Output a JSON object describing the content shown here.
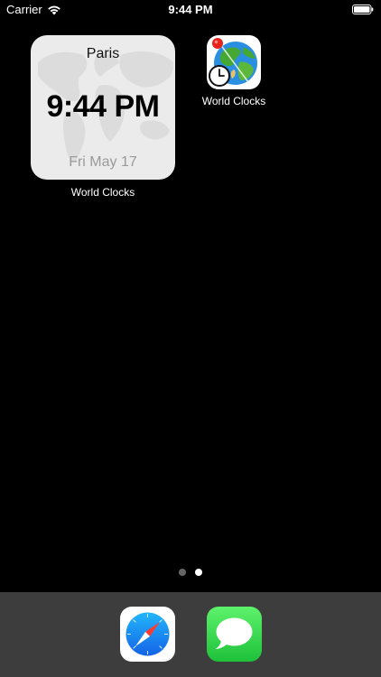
{
  "status_bar": {
    "carrier": "Carrier",
    "time": "9:44 PM",
    "wifi_icon": "wifi-icon",
    "battery_icon": "battery-icon"
  },
  "widget": {
    "city": "Paris",
    "time": "9:44 PM",
    "date": "Fri May 17",
    "label": "World Clocks"
  },
  "app": {
    "label": "World Clocks",
    "icon": "globe-clock-icon"
  },
  "page_dots": {
    "count": 2,
    "active_index": 1
  },
  "dock": {
    "apps": [
      {
        "name": "safari",
        "icon": "safari-compass-icon"
      },
      {
        "name": "messages",
        "icon": "messages-bubble-icon"
      }
    ]
  },
  "colors": {
    "background": "#000000",
    "dock": "#3d3d3d",
    "widget_bg": "#ebebeb",
    "date_text": "#9a9a9a",
    "messages_green": "#2fd14a",
    "safari_blue": "#1c8ef9"
  }
}
